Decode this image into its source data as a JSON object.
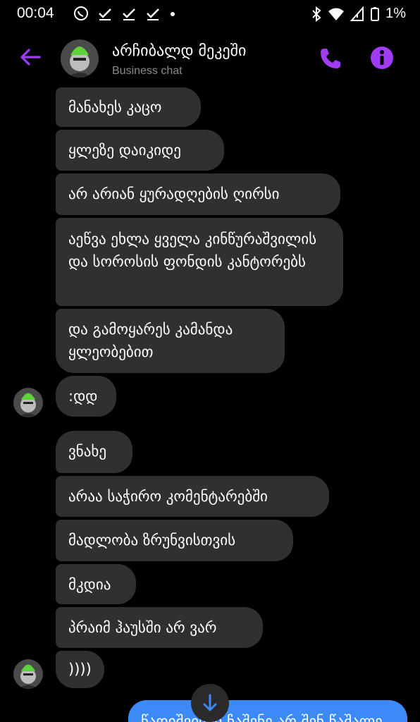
{
  "status": {
    "time": "00:04",
    "battery": "1%"
  },
  "header": {
    "name": "არჩიბალდ მეკეში",
    "subtitle": "Business chat"
  },
  "messages": [
    "მანახეს კაცო",
    "ყლეზე დაიკიდე",
    "არ არიან ყურადღების ღირსი",
    "აეწვა ეხლა ყველა კინწურაშვილის და სოროსის ფონდის კანტორებს",
    "და გამოყარეს კამანდა ყლეობებით",
    ":დდ",
    "ვნახე",
    "არაა საჭირო კომენტარებში",
    "მადლობა ზრუნვისთვის",
    "მკდია",
    "პრაიმ ჰაუსში არ ვარ",
    "))))"
  ],
  "sent": {
    "partial_text": "წადიშვილი ჩაშენე არ შენ წაშალე"
  },
  "colors": {
    "accent": "#a03cf5",
    "bubble_received": "#303030",
    "bubble_sent": "#3b8af5",
    "background": "#000000"
  },
  "icons": [
    "back-arrow-icon",
    "phone-icon",
    "info-icon",
    "arrow-down-icon"
  ]
}
